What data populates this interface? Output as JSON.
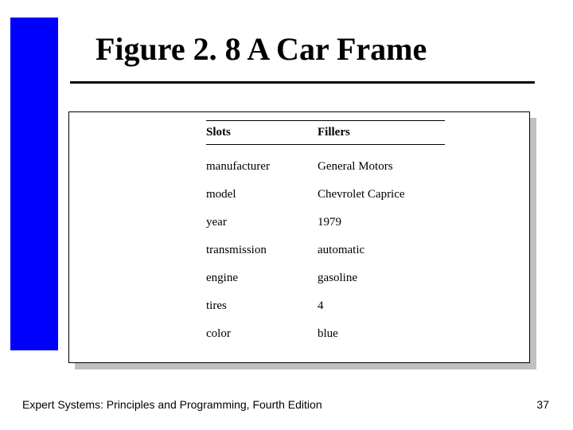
{
  "title": "Figure 2. 8 A Car Frame",
  "table": {
    "headers": {
      "slots": "Slots",
      "fillers": "Fillers"
    },
    "rows": [
      {
        "slot": "manufacturer",
        "filler": "General Motors"
      },
      {
        "slot": "model",
        "filler": "Chevrolet Caprice"
      },
      {
        "slot": "year",
        "filler": "1979"
      },
      {
        "slot": "transmission",
        "filler": "automatic"
      },
      {
        "slot": "engine",
        "filler": "gasoline"
      },
      {
        "slot": "tires",
        "filler": "4"
      },
      {
        "slot": "color",
        "filler": "blue"
      }
    ]
  },
  "footer": "Expert Systems: Principles and Programming, Fourth Edition",
  "page_number": "37"
}
